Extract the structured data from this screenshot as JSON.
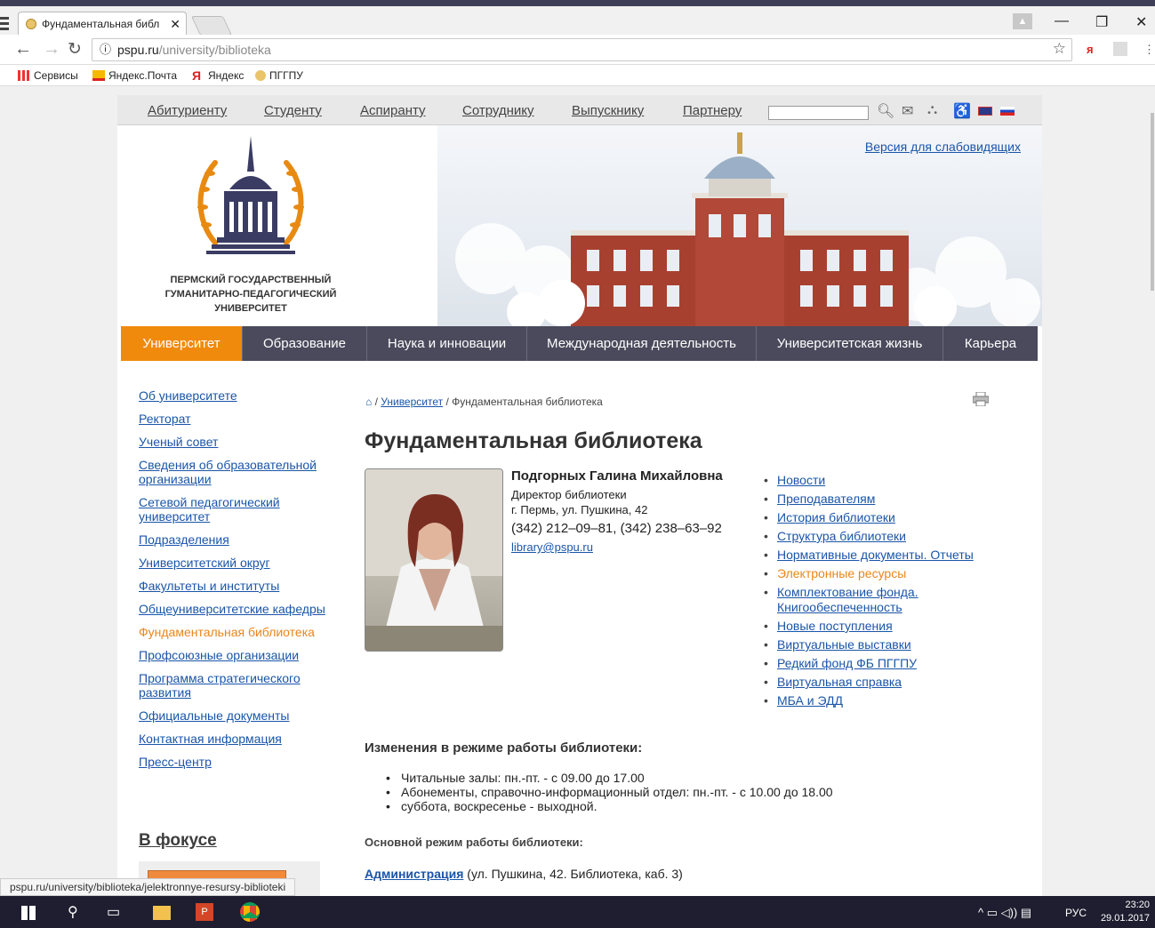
{
  "browser": {
    "tab_title": "Фундаментальная библ",
    "tab_close": "✕",
    "url_host": "pspu.ru",
    "url_path": "/university/biblioteka",
    "status_url": "pspu.ru/university/biblioteka/jelektronnye-resursy-biblioteki"
  },
  "bookmarks": [
    {
      "label": "Сервисы",
      "icon": "apps-icon"
    },
    {
      "label": "Яндекс.Почта",
      "icon": "yandex-mail-icon"
    },
    {
      "label": "Яндекс",
      "icon": "yandex-icon"
    },
    {
      "label": "ПГГПУ",
      "icon": "pspu-icon"
    }
  ],
  "topnav": {
    "items": [
      "Абитуриенту",
      "Студенту",
      "Аспиранту",
      "Сотруднику",
      "Выпускнику",
      "Партнеру"
    ]
  },
  "header": {
    "lowvision": "Версия для слабовидящих",
    "logo_line1": "ПЕРМСКИЙ ГОСУДАРСТВЕННЫЙ",
    "logo_line2": "ГУМАНИТАРНО-ПЕДАГОГИЧЕСКИЙ",
    "logo_line3": "УНИВЕРСИТЕТ"
  },
  "mainnav": {
    "items": [
      "Университет",
      "Образование",
      "Наука и инновации",
      "Международная деятельность",
      "Университетская жизнь",
      "Карьера"
    ]
  },
  "sidebar": {
    "items": [
      "Об университете",
      "Ректорат",
      "Ученый совет",
      "Сведения об образовательной организации",
      "Сетевой педагогический университет",
      "Подразделения",
      "Университетский округ",
      "Факультеты и институты",
      "Общеуниверситетские кафедры",
      "Фундаментальная библиотека",
      "Профсоюзные организации",
      "Программа стратегического развития",
      "Официальные документы",
      "Контактная информация",
      "Пресс-центр"
    ],
    "focus": "В фокусе"
  },
  "breadcrumb": {
    "sep": "/",
    "parent": "Университет",
    "current": "Фундаментальная библиотека"
  },
  "page": {
    "title": "Фундаментальная библиотека",
    "director_name": "Подгорных Галина Михайловна",
    "director_role": "Директор библиотеки",
    "director_address": "г. Пермь, ул. Пушкина, 42",
    "director_phone": "(342) 212–09–81, (342) 238–63–92",
    "director_email": "library@pspu.ru",
    "hours_heading": "Изменения в режиме работы библиотеки:",
    "hours": [
      "Читальные залы: пн.-пт. - с 09.00 до 17.00",
      "Абонементы, справочно-информационный отдел: пн.-пт. - с 10.00 до 18.00",
      "суббота, воскресенье - выходной."
    ],
    "mode_heading": "Основной режим работы библиотеки:",
    "admin_link": "Администрация",
    "admin_text": "(ул. Пушкина, 42. Библиотека, каб. 3)"
  },
  "library_links": [
    "Новости",
    "Преподавателям",
    "История библиотеки",
    "Структура библиотеки",
    "Нормативные документы. Отчеты",
    "Электронные ресурсы",
    "Комплектование фонда. Книгообеспеченность",
    "Новые поступления",
    "Виртуальные выставки",
    "Редкий фонд ФБ ПГГПУ",
    "Виртуальная справка",
    "МБА и ЭДД"
  ],
  "taskbar": {
    "lang": "РУС",
    "time": "23:20",
    "date": "29.01.2017"
  },
  "colors": {
    "accent_orange": "#f08a0c",
    "nav_dark": "#4a4a5c",
    "link_blue": "#1a55a8"
  }
}
